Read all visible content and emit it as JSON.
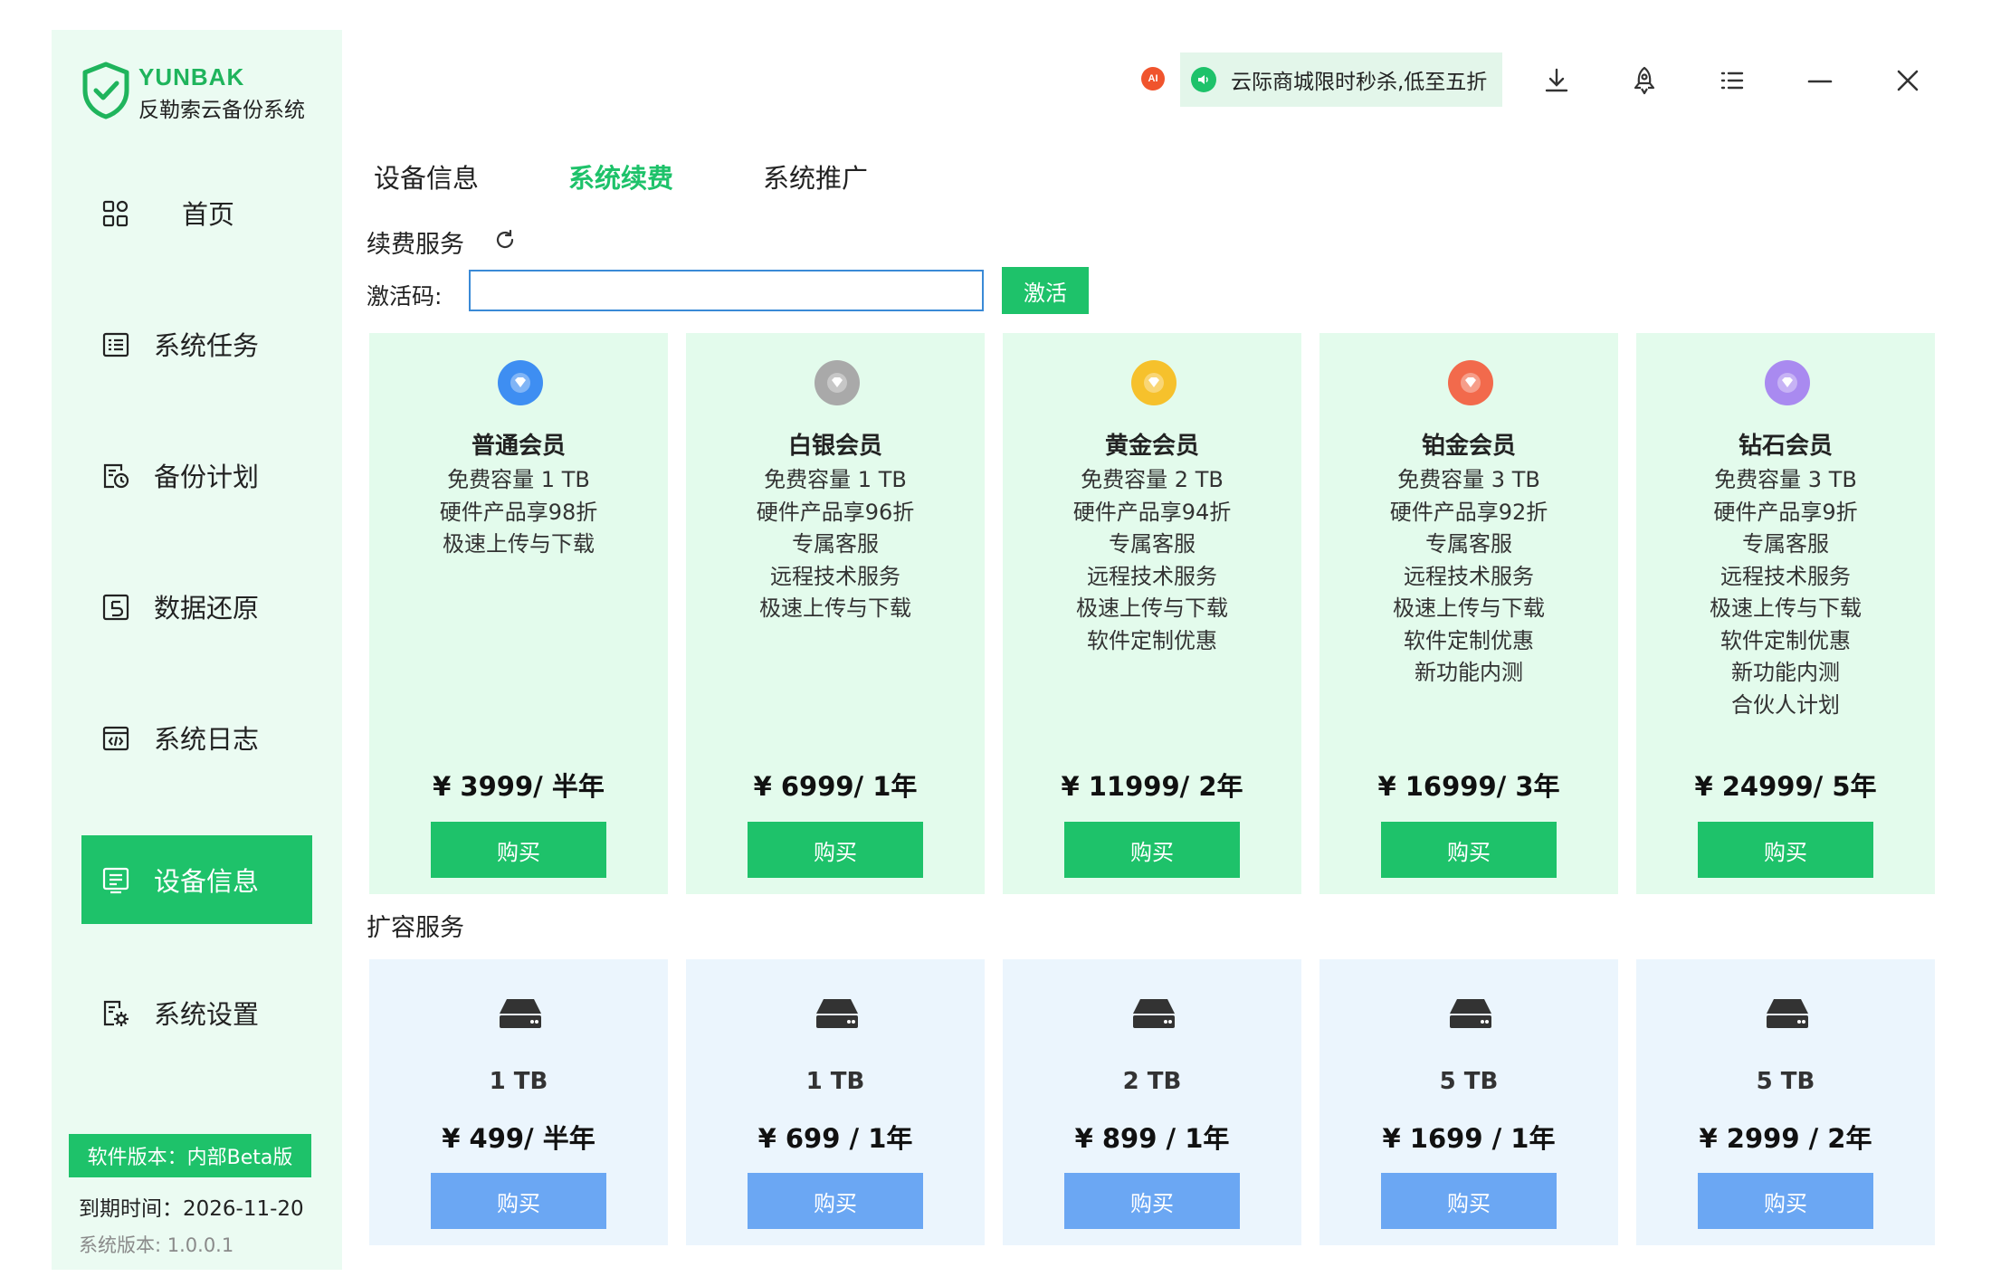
{
  "brand": {
    "name": "YUNBAK",
    "subtitle": "反勒索云备份系统"
  },
  "sidebar": {
    "items": [
      {
        "label": "首页",
        "icon": "grid-icon",
        "active": false
      },
      {
        "label": "系统任务",
        "icon": "task-list-icon",
        "active": false
      },
      {
        "label": "备份计划",
        "icon": "backup-plan-icon",
        "active": false
      },
      {
        "label": "数据还原",
        "icon": "restore-icon",
        "active": false
      },
      {
        "label": "系统日志",
        "icon": "log-icon",
        "active": false
      },
      {
        "label": "设备信息",
        "icon": "device-info-icon",
        "active": true
      },
      {
        "label": "系统设置",
        "icon": "settings-icon",
        "active": false
      }
    ],
    "version_badge": "软件版本：内部Beta版",
    "expiry": "到期时间：2026-11-20",
    "system_version": "系统版本: 1.0.0.1"
  },
  "topbar": {
    "ai_badge": "AI",
    "promo_text": "云际商城限时秒杀,低至五折",
    "icons": [
      "download-icon",
      "rocket-icon",
      "menu-icon",
      "minimize-icon",
      "close-icon"
    ]
  },
  "tabs": [
    {
      "label": "设备信息",
      "active": false
    },
    {
      "label": "系统续费",
      "active": true
    },
    {
      "label": "系统推广",
      "active": false
    }
  ],
  "renewal": {
    "title": "续费服务",
    "activation_label": "激活码:",
    "activation_value": "",
    "activate_button": "激活"
  },
  "plans": [
    {
      "name": "普通会员",
      "color": "#3e8ef2",
      "features": [
        "免费容量 1 TB",
        "硬件产品享98折",
        "极速上传与下载"
      ],
      "price": "¥ 3999/ 半年",
      "buy": "购买"
    },
    {
      "name": "白银会员",
      "color": "#a9a9a9",
      "features": [
        "免费容量 1 TB",
        "硬件产品享96折",
        "专属客服",
        "远程技术服务",
        "极速上传与下载"
      ],
      "price": "¥ 6999/ 1年",
      "buy": "购买"
    },
    {
      "name": "黄金会员",
      "color": "#f6c12c",
      "features": [
        "免费容量 2 TB",
        "硬件产品享94折",
        "专属客服",
        "远程技术服务",
        "极速上传与下载",
        "软件定制优惠"
      ],
      "price": "¥ 11999/ 2年",
      "buy": "购买"
    },
    {
      "name": "铂金会员",
      "color": "#f26a4c",
      "features": [
        "免费容量 3 TB",
        "硬件产品享92折",
        "专属客服",
        "远程技术服务",
        "极速上传与下载",
        "软件定制优惠",
        "新功能内测"
      ],
      "price": "¥ 16999/ 3年",
      "buy": "购买"
    },
    {
      "name": "钻石会员",
      "color": "#a98af0",
      "features": [
        "免费容量 3 TB",
        "硬件产品享9折",
        "专属客服",
        "远程技术服务",
        "极速上传与下载",
        "软件定制优惠",
        "新功能内测",
        "合伙人计划"
      ],
      "price": "¥ 24999/ 5年",
      "buy": "购买"
    }
  ],
  "expansion": {
    "title": "扩容服务",
    "items": [
      {
        "capacity": "1 TB",
        "price": "¥ 499/ 半年",
        "buy": "购买"
      },
      {
        "capacity": "1 TB",
        "price": "¥ 699 / 1年",
        "buy": "购买"
      },
      {
        "capacity": "2 TB",
        "price": "¥ 899 / 1年",
        "buy": "购买"
      },
      {
        "capacity": "5 TB",
        "price": "¥ 1699 / 1年",
        "buy": "购买"
      },
      {
        "capacity": "5 TB",
        "price": "¥ 2999 / 2年",
        "buy": "购买"
      }
    ]
  },
  "colors": {
    "accent": "#1ec26a",
    "storage_button": "#6ba7f3",
    "plan_card": "#e3fbec",
    "storage_card": "#ebf5fd",
    "sidebar": "#ebfbf2"
  }
}
